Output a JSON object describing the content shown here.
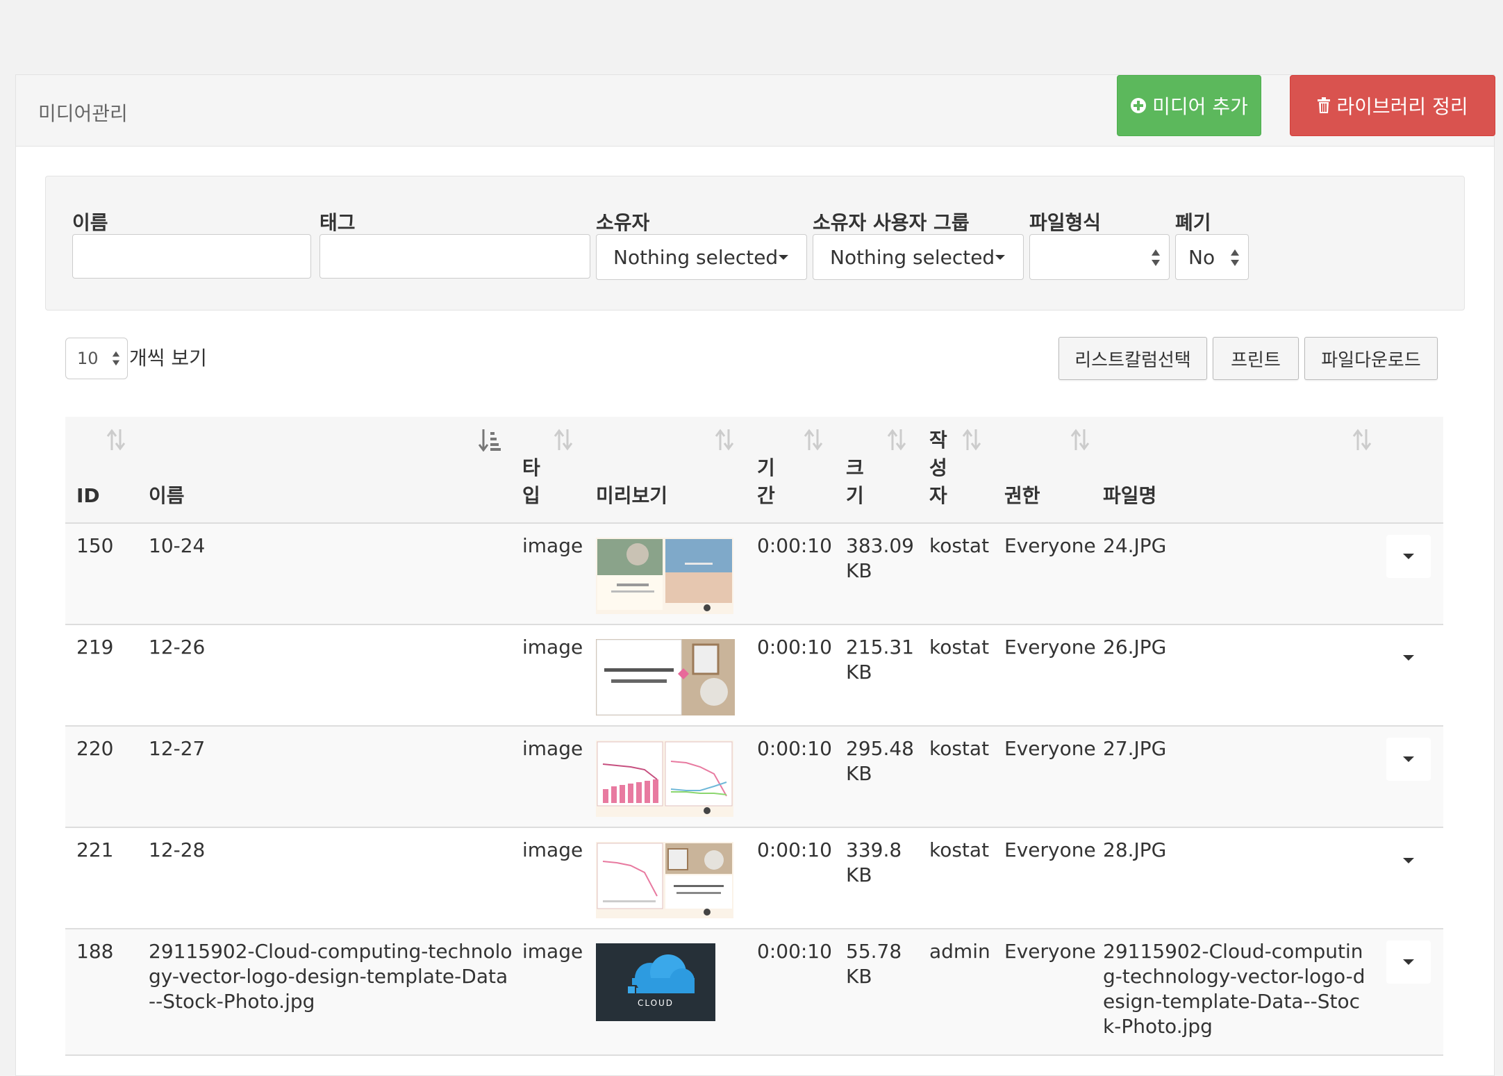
{
  "page": {
    "title": "미디어관리"
  },
  "actions": {
    "add_media": "미디어 추가",
    "clean_library": "라이브러리 정리"
  },
  "filters": {
    "name_label": "이름",
    "name_value": "",
    "tag_label": "태그",
    "tag_value": "",
    "owner_label": "소유자",
    "owner_value": "Nothing selected",
    "owner_group_label": "소유자 사용자 그룹",
    "owner_group_value": "Nothing selected",
    "file_type_label": "파일형식",
    "file_type_value": "",
    "retired_label": "폐기",
    "retired_value": "No"
  },
  "table_controls": {
    "page_length": "10",
    "page_length_label": "개씩 보기",
    "column_select": "리스트칼럼선택",
    "print": "프린트",
    "download": "파일다운로드"
  },
  "columns": {
    "id": "ID",
    "name": "이름",
    "type": "타입",
    "preview": "미리보기",
    "duration": "기간",
    "size": "크기",
    "owner": "작성자",
    "permission": "권한",
    "filename": "파일명"
  },
  "rows": [
    {
      "id": "150",
      "name": "10-24",
      "type": "image",
      "duration": "0:00:10",
      "size": "383.09",
      "size_unit": "KB",
      "owner": "kostat",
      "permission": "Everyone",
      "filename": "24.JPG"
    },
    {
      "id": "219",
      "name": "12-26",
      "type": "image",
      "duration": "0:00:10",
      "size": "215.31",
      "size_unit": "KB",
      "owner": "kostat",
      "permission": "Everyone",
      "filename": "26.JPG"
    },
    {
      "id": "220",
      "name": "12-27",
      "type": "image",
      "duration": "0:00:10",
      "size": "295.48",
      "size_unit": "KB",
      "owner": "kostat",
      "permission": "Everyone",
      "filename": "27.JPG"
    },
    {
      "id": "221",
      "name": "12-28",
      "type": "image",
      "duration": "0:00:10",
      "size": "339.8",
      "size_unit": "KB",
      "owner": "kostat",
      "permission": "Everyone",
      "filename": "28.JPG"
    },
    {
      "id": "188",
      "name": "29115902-Cloud-computing-technology-vector-logo-design-template-Data--Stock-Photo.jpg",
      "type": "image",
      "duration": "0:00:10",
      "size": "55.78",
      "size_unit": "KB",
      "owner": "admin",
      "permission": "Everyone",
      "filename": "29115902-Cloud-computing-technology-vector-logo-design-template-Data--Stock-Photo.jpg",
      "preview_text": "CLOUD"
    }
  ],
  "colors": {
    "success": "#5cb85c",
    "danger": "#d9534f"
  }
}
